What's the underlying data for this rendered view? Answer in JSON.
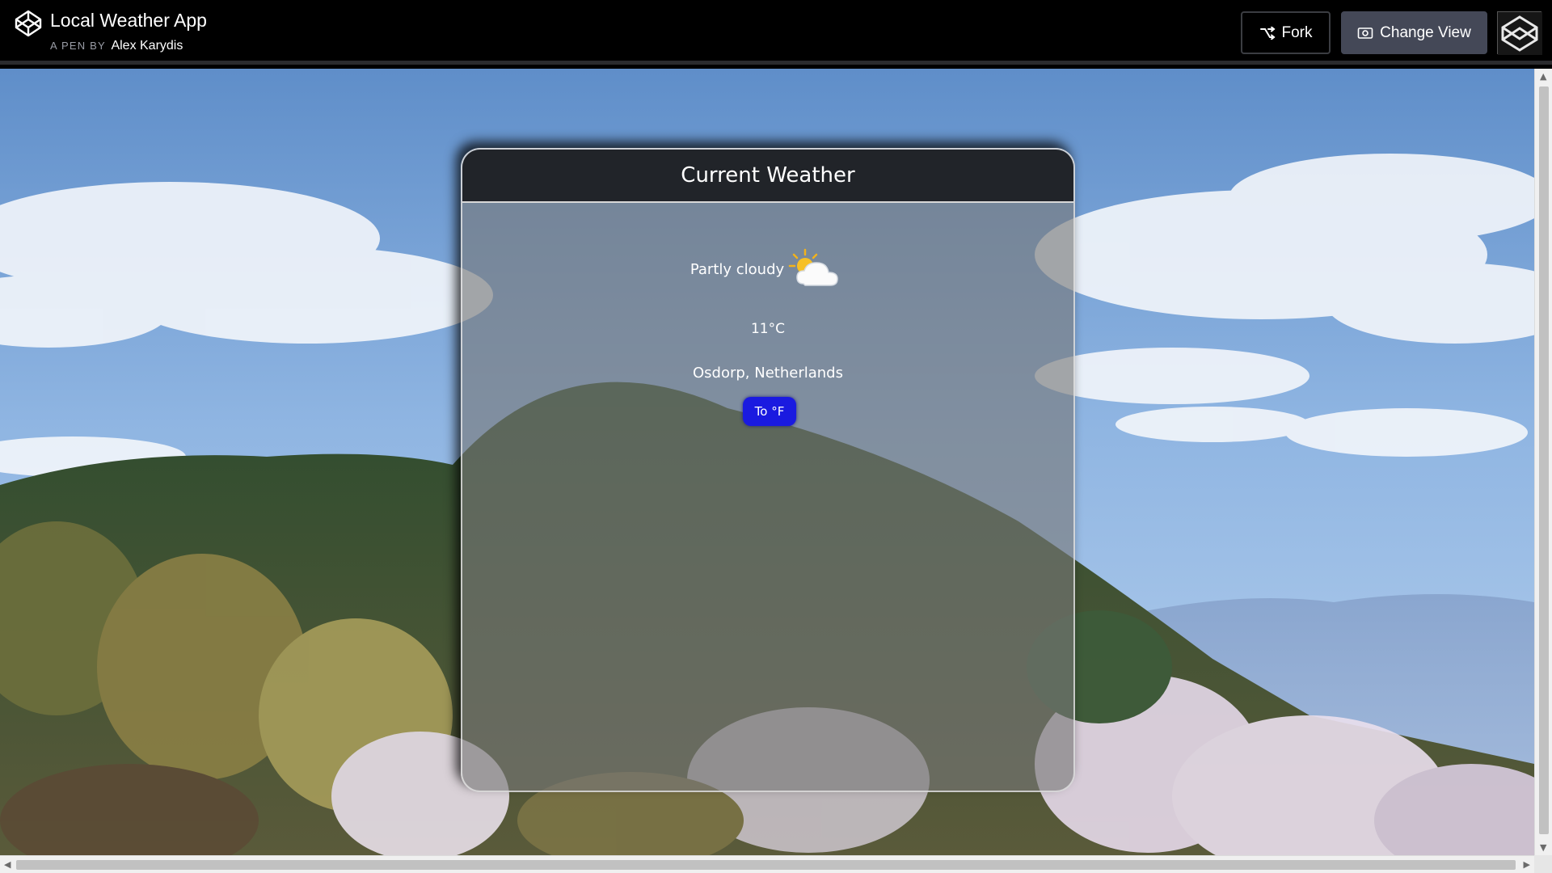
{
  "header": {
    "title": "Local Weather App",
    "by_prefix": "A PEN BY",
    "author": "Alex Karydis",
    "fork_label": "Fork",
    "change_view_label": "Change View"
  },
  "weather": {
    "card_title": "Current Weather",
    "condition": "Partly cloudy",
    "condition_icon": "partly-cloudy-icon",
    "temperature": "11°C",
    "location": "Osdorp, Netherlands",
    "toggle_label": "To °F"
  },
  "colors": {
    "toggle_button": "#1a1ae0",
    "card_header": "#212429",
    "topbar": "#000000",
    "change_view_button": "#444857"
  }
}
